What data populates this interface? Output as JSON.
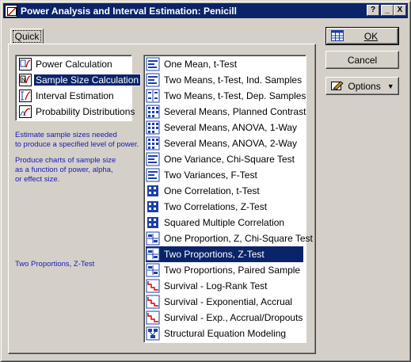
{
  "window": {
    "title": "Power Analysis and Interval Estimation: Penicill",
    "controls": [
      "?",
      "_",
      "X"
    ]
  },
  "tab": {
    "label": "Quick"
  },
  "modes": [
    {
      "label": "Power Calculation",
      "icon": "power-calculation-icon",
      "selected": false
    },
    {
      "label": "Sample Size Calculation",
      "icon": "sample-size-icon",
      "selected": true
    },
    {
      "label": "Interval Estimation",
      "icon": "interval-estimation-icon",
      "selected": false
    },
    {
      "label": "Probability Distributions",
      "icon": "probability-distributions-icon",
      "selected": false
    }
  ],
  "description": {
    "line1": "Estimate sample sizes needed",
    "line2": "to produce a specified level of power.",
    "line3": "Produce charts of sample size",
    "line4": "as a function of power, alpha,",
    "line5": "or effect size.",
    "current": "Two Proportions, Z-Test"
  },
  "tests": [
    {
      "label": "One Mean, t-Test",
      "icon": "bars-icon",
      "selected": false
    },
    {
      "label": "Two Means, t-Test, Ind. Samples",
      "icon": "bars-icon",
      "selected": false
    },
    {
      "label": "Two Means, t-Test, Dep. Samples",
      "icon": "paired-icon",
      "selected": false
    },
    {
      "label": "Several Means, Planned Contrast",
      "icon": "grid-icon",
      "selected": false
    },
    {
      "label": "Several Means, ANOVA, 1-Way",
      "icon": "grid-icon",
      "selected": false
    },
    {
      "label": "Several Means, ANOVA, 2-Way",
      "icon": "grid-icon",
      "selected": false
    },
    {
      "label": "One Variance, Chi-Square Test",
      "icon": "bars-icon",
      "selected": false
    },
    {
      "label": "Two Variances, F-Test",
      "icon": "bars-icon",
      "selected": false
    },
    {
      "label": "One Correlation, t-Test",
      "icon": "correlation-icon",
      "selected": false
    },
    {
      "label": "Two Correlations, Z-Test",
      "icon": "correlation-icon",
      "selected": false
    },
    {
      "label": "Squared Multiple Correlation",
      "icon": "correlation-icon",
      "selected": false
    },
    {
      "label": "One Proportion, Z, Chi-Square Test",
      "icon": "proportion-icon",
      "selected": false
    },
    {
      "label": "Two Proportions, Z-Test",
      "icon": "proportion-icon",
      "selected": true
    },
    {
      "label": "Two Proportions, Paired Sample",
      "icon": "proportion-icon",
      "selected": false
    },
    {
      "label": "Survival - Log-Rank Test",
      "icon": "survival-icon",
      "selected": false
    },
    {
      "label": "Survival - Exponential, Accrual",
      "icon": "survival-icon",
      "selected": false
    },
    {
      "label": "Survival - Exp., Accrual/Dropouts",
      "icon": "survival-icon",
      "selected": false
    },
    {
      "label": "Structural Equation Modeling",
      "icon": "sem-icon",
      "selected": false
    }
  ],
  "buttons": {
    "ok": "OK",
    "cancel": "Cancel",
    "options": "Options",
    "options_arrow": "▼"
  },
  "colors": {
    "titlebar": "#0a246a",
    "selection": "#0a246a",
    "face": "#d4d0c8",
    "description_text": "#1a1ab4",
    "icon_blue": "#1a3fa8",
    "icon_red": "#cc0000"
  }
}
